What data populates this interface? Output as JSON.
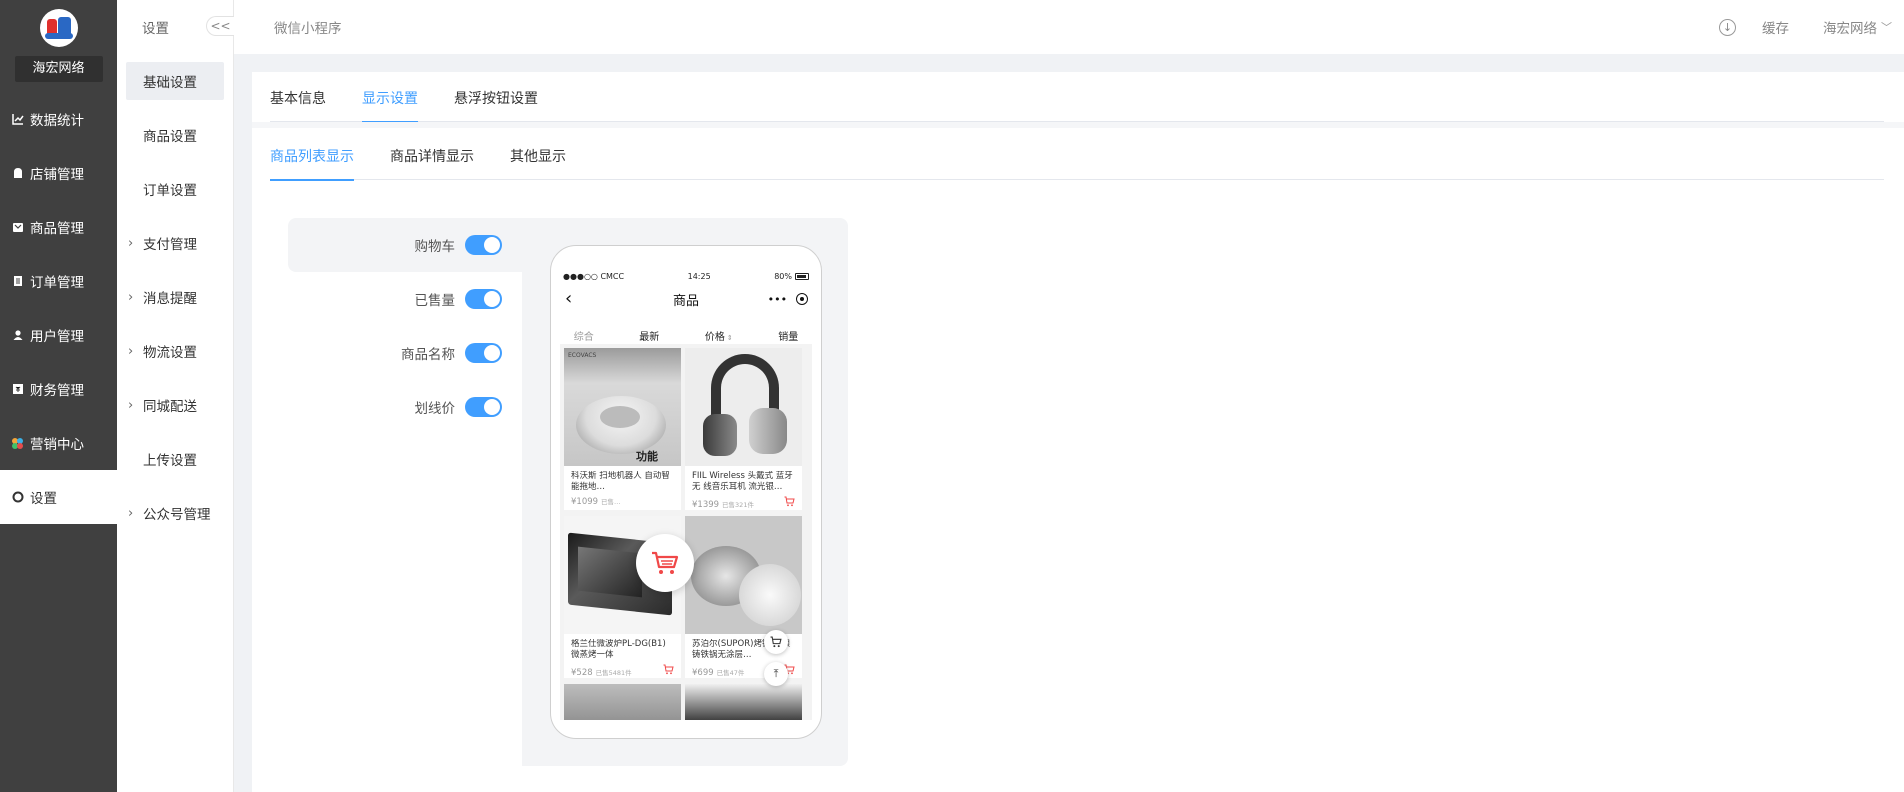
{
  "brand": {
    "name": "海宏网络"
  },
  "sidebar": {
    "items": [
      {
        "label": "数据统计",
        "icon": "chart-icon"
      },
      {
        "label": "店铺管理",
        "icon": "shop-icon"
      },
      {
        "label": "商品管理",
        "icon": "goods-icon"
      },
      {
        "label": "订单管理",
        "icon": "order-icon"
      },
      {
        "label": "用户管理",
        "icon": "user-icon"
      },
      {
        "label": "财务管理",
        "icon": "finance-icon"
      },
      {
        "label": "营销中心",
        "icon": "marketing-icon"
      },
      {
        "label": "设置",
        "icon": "settings-icon"
      }
    ]
  },
  "subnav": {
    "title": "设置",
    "collapse_label": "<<",
    "items": [
      {
        "label": "基础设置"
      },
      {
        "label": "商品设置"
      },
      {
        "label": "订单设置"
      },
      {
        "label": "支付管理"
      },
      {
        "label": "消息提醒"
      },
      {
        "label": "物流设置"
      },
      {
        "label": "同城配送"
      },
      {
        "label": "上传设置"
      },
      {
        "label": "公众号管理"
      }
    ]
  },
  "header": {
    "breadcrumb": "微信小程序",
    "cache_label": "缓存",
    "user_name": "海宏网络"
  },
  "tabs": {
    "primary": [
      "基本信息",
      "显示设置",
      "悬浮按钮设置"
    ],
    "secondary": [
      "商品列表显示",
      "商品详情显示",
      "其他显示"
    ]
  },
  "settings": {
    "fields": [
      {
        "label": "购物车",
        "enabled": true
      },
      {
        "label": "已售量",
        "enabled": true
      },
      {
        "label": "商品名称",
        "enabled": true
      },
      {
        "label": "划线价",
        "enabled": true
      }
    ]
  },
  "phone": {
    "status": {
      "carrier": "●●●○○ CMCC",
      "time": "14:25",
      "battery": "80%"
    },
    "title": "商品",
    "capsule_dots": "•••",
    "filters": [
      "综合",
      "最新",
      "价格",
      "销量"
    ],
    "products": [
      {
        "name": "科沃斯 扫地机器人 自动智能拖地…",
        "price": "¥1099",
        "sold": "已售…",
        "brand_text": "ECOVACS",
        "overlay": "功能"
      },
      {
        "name": "FIIL Wireless 头戴式 蓝牙无 线音乐耳机 流光银…",
        "price": "¥1399",
        "sold": "已售321件"
      },
      {
        "name": "格兰仕微波炉PL-DG(B1) 微蒸烤一体",
        "price": "¥528",
        "sold": "已售5481件"
      },
      {
        "name": "苏泊尔(SUPOR)烤锅 珐琅铸铁锅无涂层…",
        "price": "¥699",
        "sold": "已售47件"
      }
    ]
  },
  "colors": {
    "primary": "#409eff",
    "sidebar_bg": "#404040",
    "cart_red": "#f04848"
  }
}
